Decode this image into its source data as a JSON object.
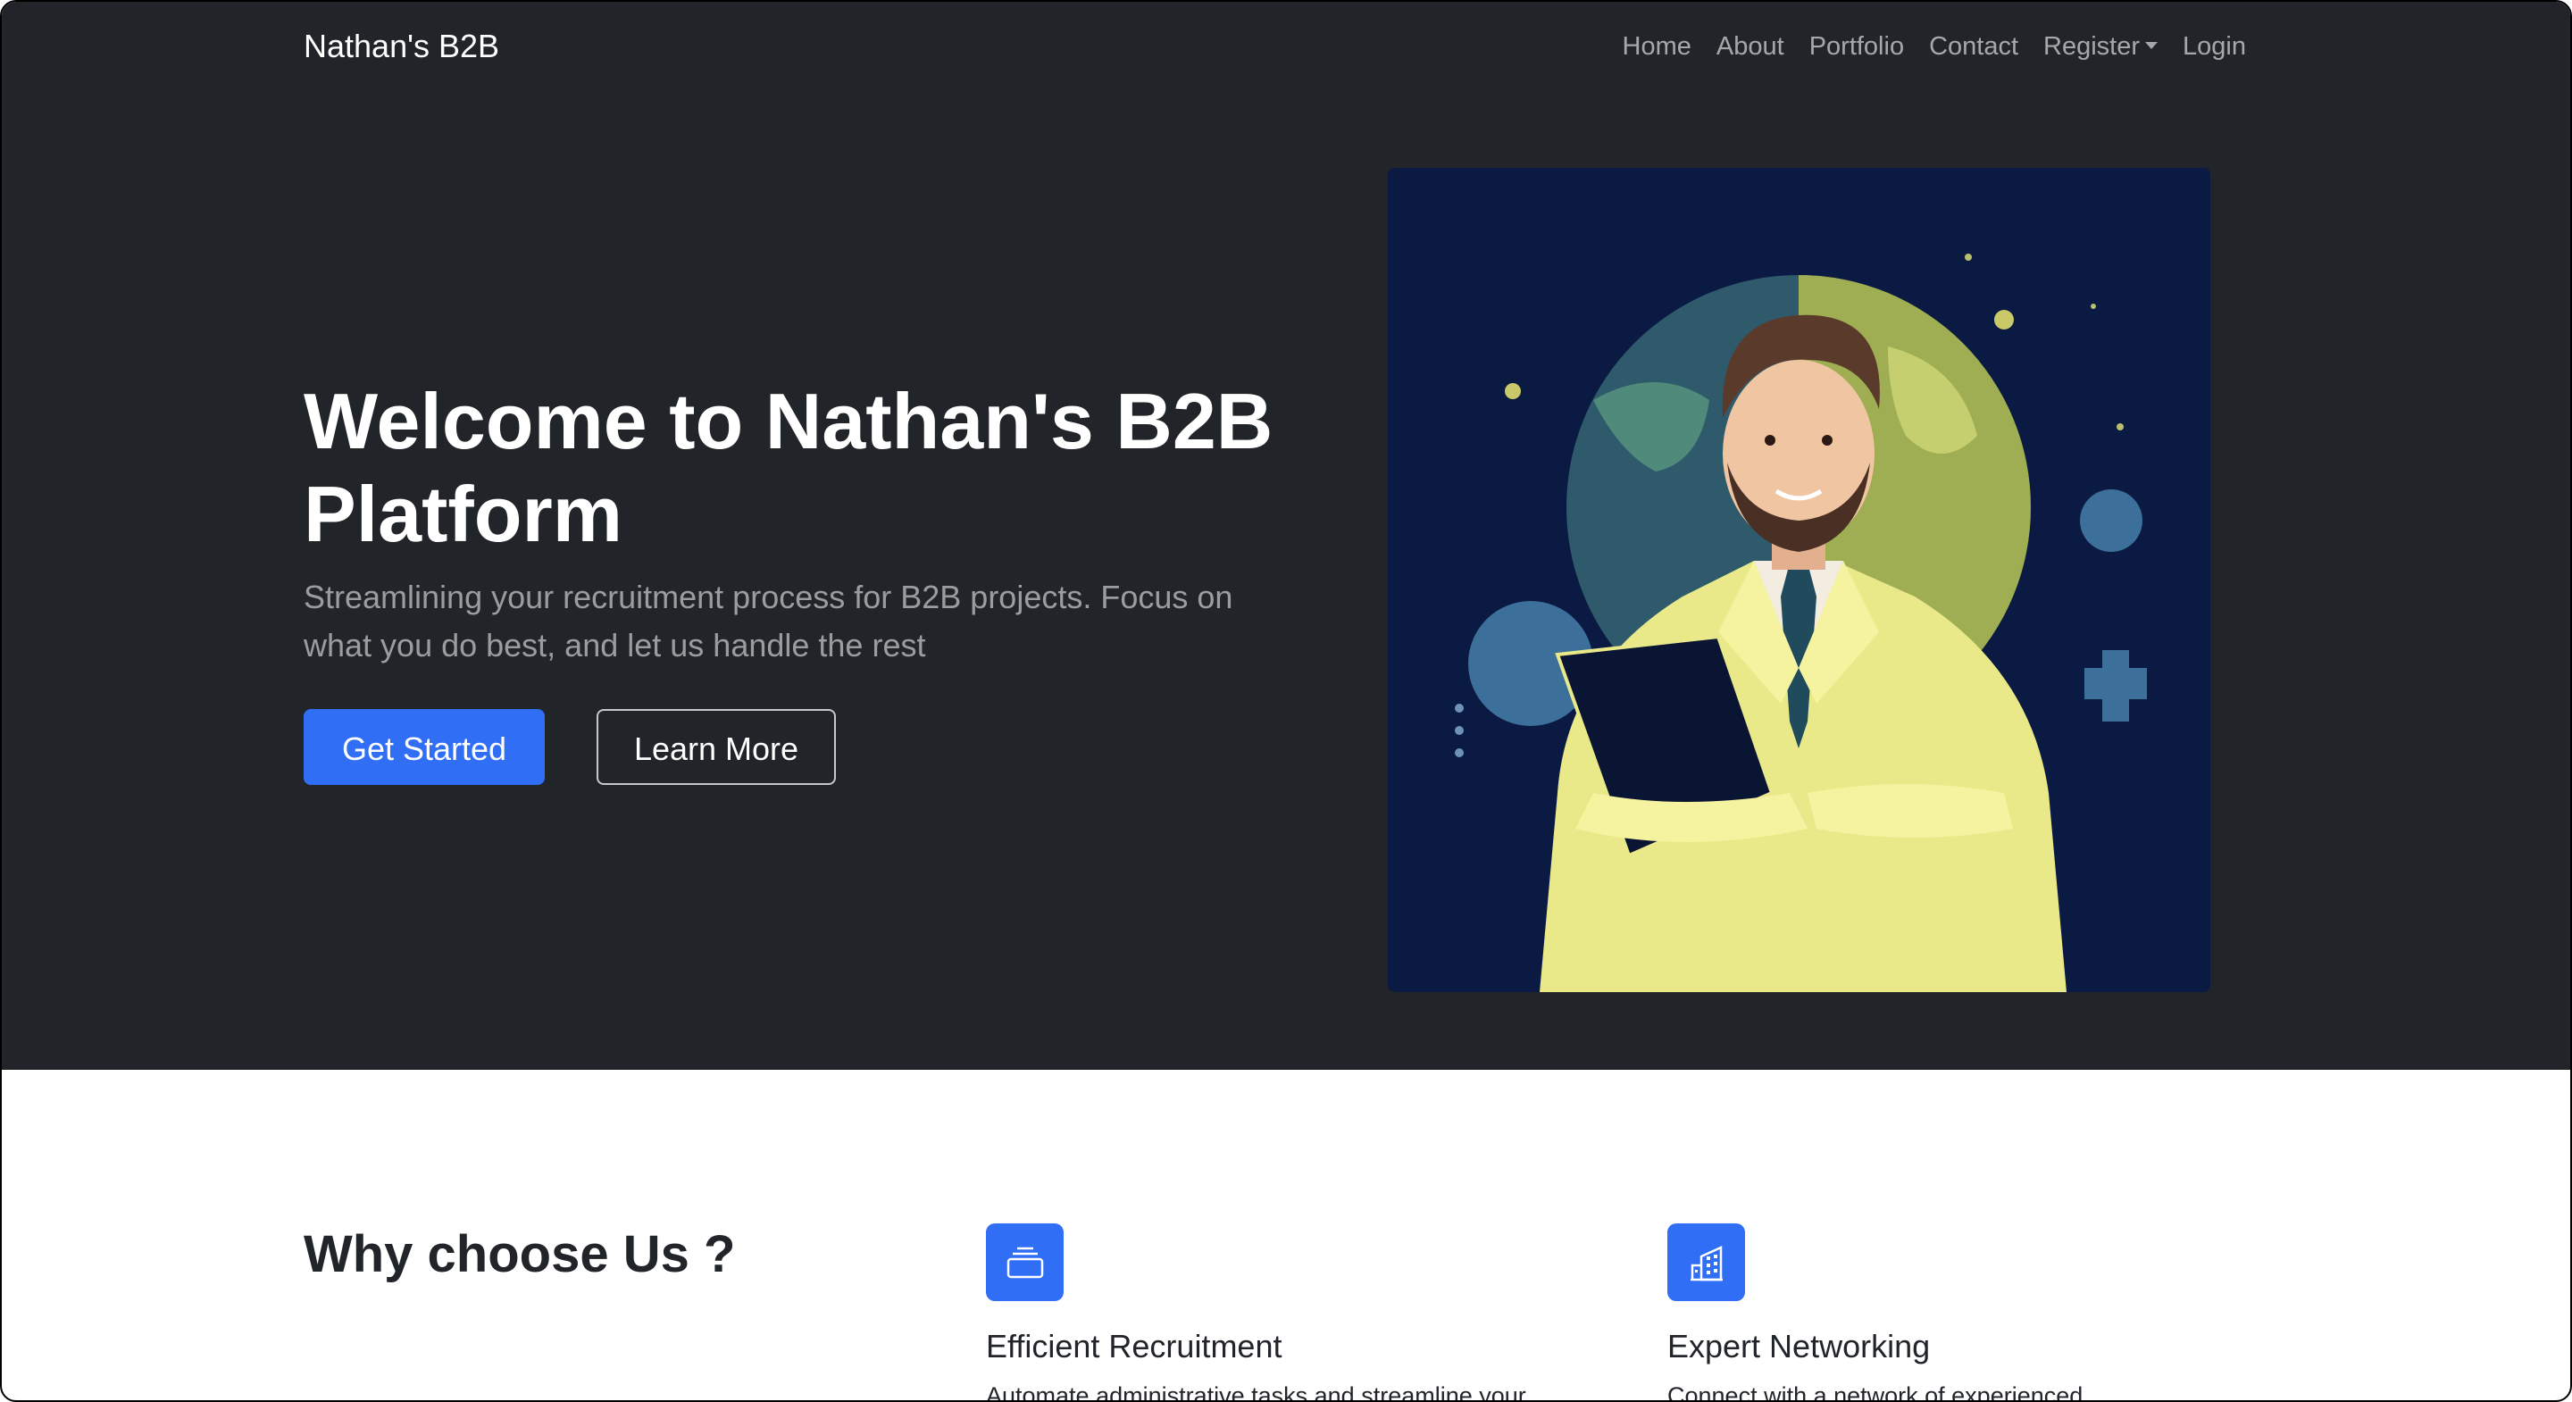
{
  "navbar": {
    "brand": "Nathan's B2B",
    "links": [
      {
        "label": "Home"
      },
      {
        "label": "About"
      },
      {
        "label": "Portfolio"
      },
      {
        "label": "Contact"
      },
      {
        "label": "Register"
      },
      {
        "label": "Login"
      }
    ]
  },
  "hero": {
    "title": "Welcome to Nathan's B2B Platform",
    "lead": "Streamlining your recruitment process for B2B projects. Focus on what you do best, and let us handle the rest",
    "primary_button": "Get Started",
    "secondary_button": "Learn More"
  },
  "features": {
    "heading": "Why choose Us ?",
    "items": [
      {
        "icon": "collection-icon",
        "title": "Efficient Recruitment",
        "text": "Automate administrative tasks and streamline your"
      },
      {
        "icon": "building-icon",
        "title": "Expert Networking",
        "text": "Connect with a network of experienced"
      }
    ]
  },
  "colors": {
    "dark_bg": "#212529",
    "accent": "#2f6ef5"
  }
}
